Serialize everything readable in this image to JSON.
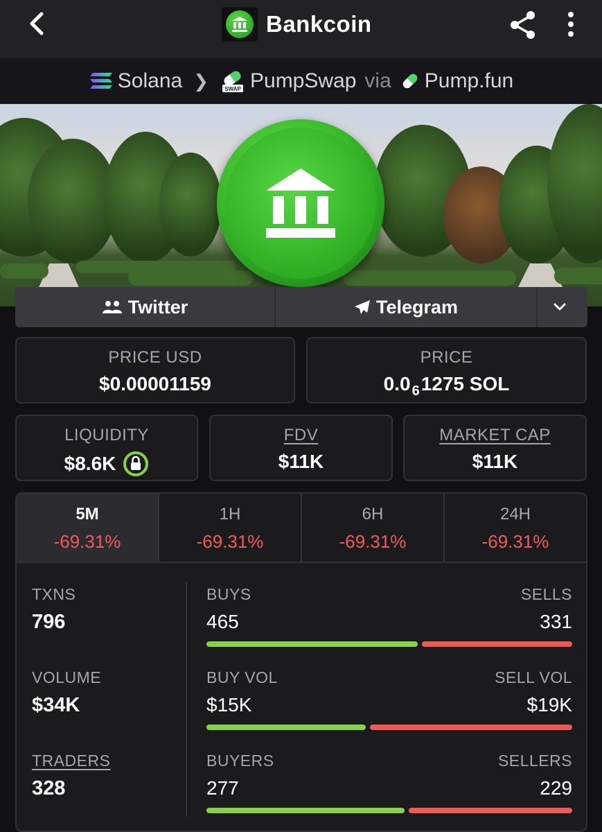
{
  "header": {
    "title": "Bankcoin",
    "back_icon": "chevron-left-icon",
    "share_icon": "share-icon",
    "more_icon": "more-vertical-icon"
  },
  "breadcrumb": {
    "chain": "Solana",
    "dex": "PumpSwap",
    "via": "via",
    "launchpad": "Pump.fun",
    "dex_icon_text": "SWAP"
  },
  "social": {
    "twitter": "Twitter",
    "telegram": "Telegram"
  },
  "prices": {
    "price_usd_label": "PRICE USD",
    "price_usd": "$0.00001159",
    "price_label": "PRICE",
    "price_prefix": "0.0",
    "price_zeros": "6",
    "price_rest": "1275 SOL"
  },
  "metrics": {
    "liquidity_label": "LIQUIDITY",
    "liquidity": "$8.6K",
    "fdv_label": "FDV",
    "fdv": "$11K",
    "mcap_label": "MARKET CAP",
    "mcap": "$11K"
  },
  "timeframes": [
    {
      "label": "5M",
      "change": "-69.31%"
    },
    {
      "label": "1H",
      "change": "-69.31%"
    },
    {
      "label": "6H",
      "change": "-69.31%"
    },
    {
      "label": "24H",
      "change": "-69.31%"
    }
  ],
  "stats": {
    "txns_label": "TXNS",
    "txns": "796",
    "volume_label": "VOLUME",
    "volume": "$34K",
    "traders_label": "TRADERS",
    "traders": "328",
    "buys_label": "BUYS",
    "buys": "465",
    "sells_label": "SELLS",
    "sells": "331",
    "buy_vol_label": "BUY VOL",
    "buy_vol": "$15K",
    "sell_vol_label": "SELL VOL",
    "sell_vol": "$19K",
    "buyers_label": "BUYERS",
    "buyers": "277",
    "sellers_label": "SELLERS",
    "sellers": "229"
  },
  "ratios": {
    "buys_fraction": 0.584,
    "buy_vol_fraction": 0.441,
    "buyers_fraction": 0.547
  },
  "colors": {
    "positive": "#8ad14b",
    "negative": "#ee5a56",
    "coin_green": "#34b427"
  }
}
